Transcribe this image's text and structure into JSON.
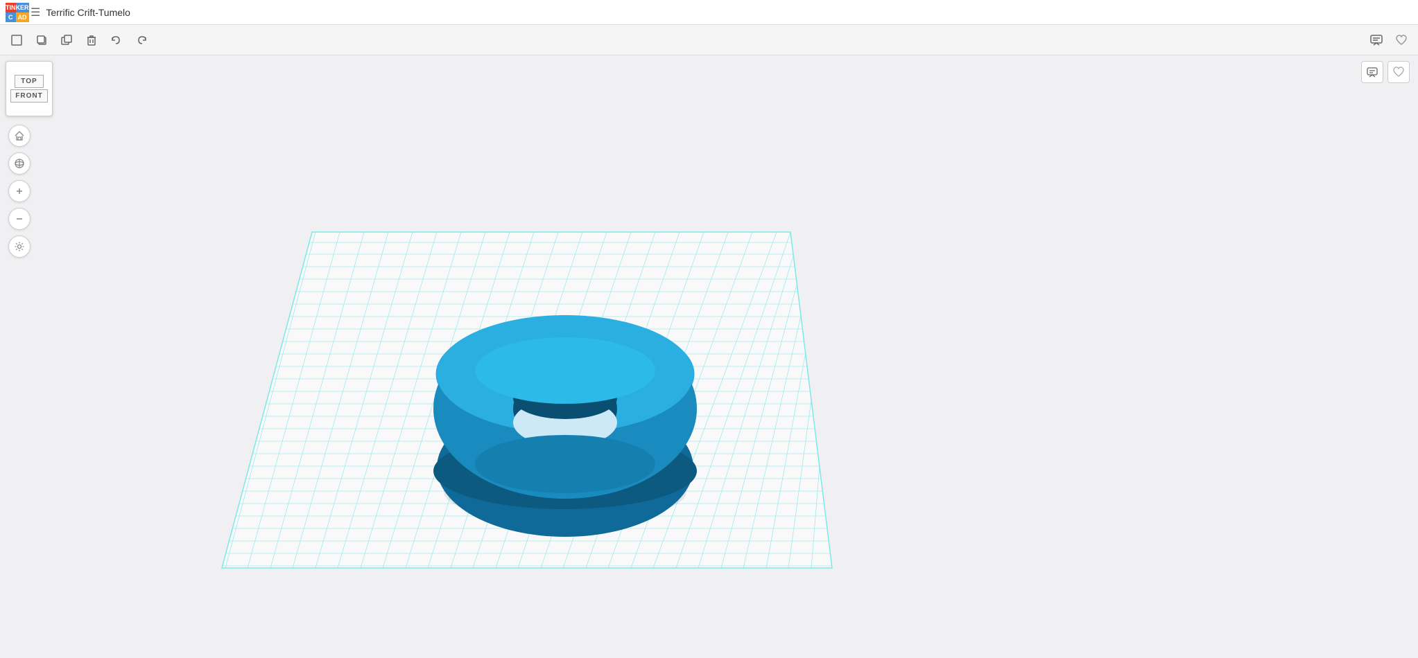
{
  "titlebar": {
    "logo": {
      "tin": "TIN",
      "ker": "KER",
      "c": "C",
      "ad": "AD"
    },
    "doc_icon": "☰",
    "title": "Terrific Crift-Tumelo"
  },
  "toolbar": {
    "new_btn": "□",
    "copy_btn": "⧉",
    "duplicate_btn": "⊞",
    "delete_btn": "🗑",
    "undo_btn": "↩",
    "redo_btn": "↪",
    "right_btn1": "💬",
    "right_btn2": "♥"
  },
  "viewcube": {
    "top_label": "TOP",
    "front_label": "FRONT"
  },
  "leftcontrols": {
    "home_icon": "⌂",
    "rotate_icon": "◎",
    "zoom_in_icon": "+",
    "zoom_out_icon": "−",
    "settings_icon": "⚙"
  },
  "scene": {
    "grid_color": "#7de8e8",
    "torus_color": "#1a8bbf",
    "torus_highlight": "#2aa8df",
    "torus_shadow": "#0f6a99"
  }
}
